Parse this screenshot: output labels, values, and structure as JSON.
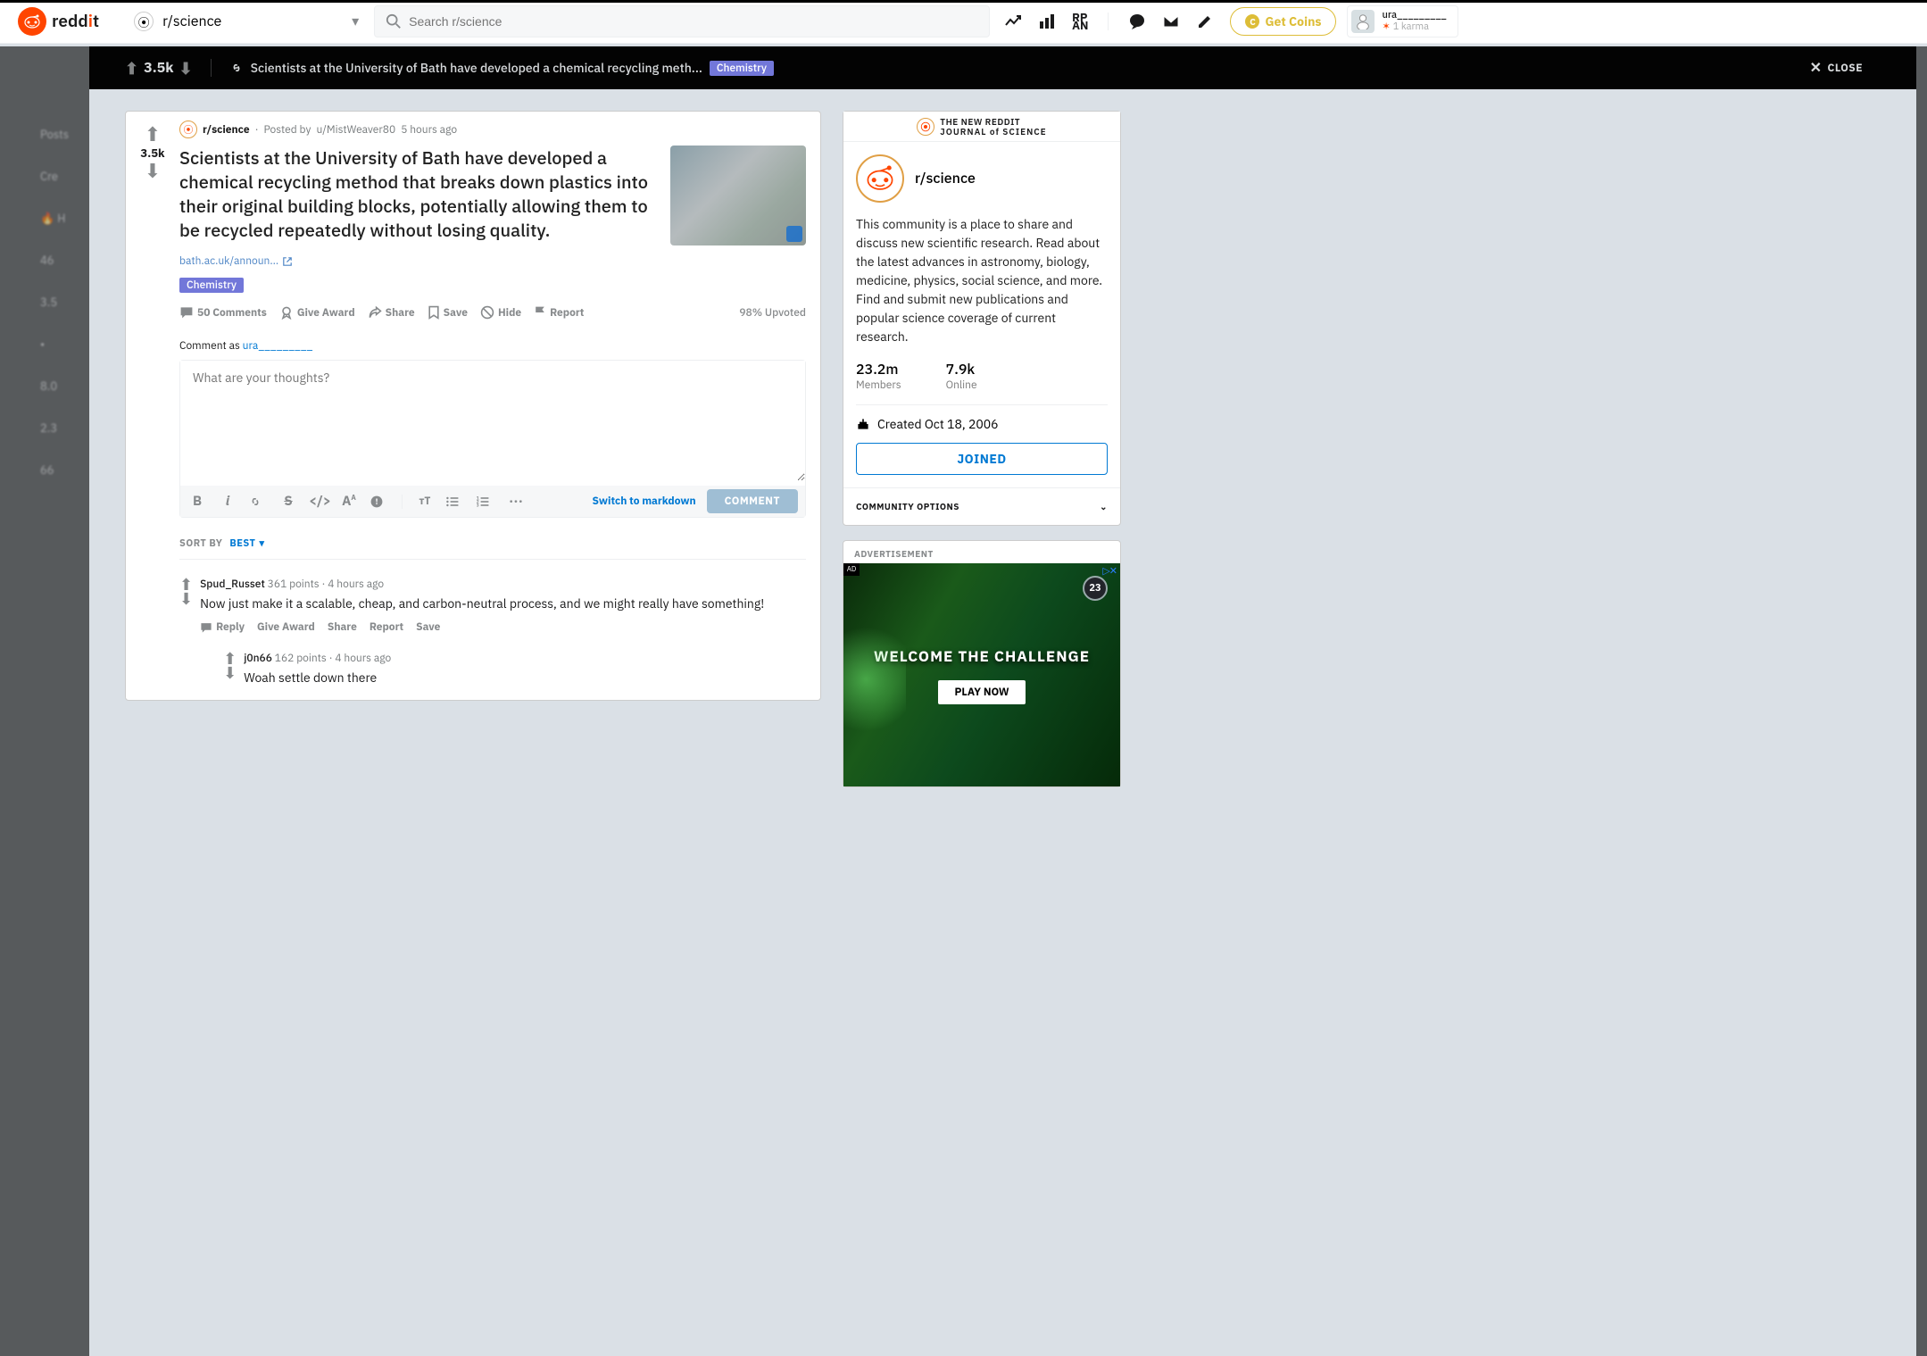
{
  "header": {
    "brand": "reddit",
    "community_selector": "r/science",
    "search_placeholder": "Search r/science",
    "coins_label": "Get Coins",
    "user": {
      "name": "ura_________",
      "karma": "1 karma"
    }
  },
  "overlay": {
    "score": "3.5k",
    "title_short": "Scientists at the University of Bath have developed a chemical recycling meth...",
    "flair": "Chemistry",
    "close": "CLOSE"
  },
  "post": {
    "score": "3.5k",
    "subreddit": "r/science",
    "posted_by_prefix": "Posted by",
    "author": "u/MistWeaver80",
    "age": "5 hours ago",
    "title": "Scientists at the University of Bath have developed a chemical recycling method that breaks down plastics into their original building blocks, potentially allowing them to be recycled repeatedly without losing quality.",
    "outlink": "bath.ac.uk/announ...",
    "flair": "Chemistry",
    "actions": {
      "comments": "50 Comments",
      "award": "Give Award",
      "share": "Share",
      "save": "Save",
      "hide": "Hide",
      "report": "Report",
      "upvoted": "98% Upvoted"
    }
  },
  "comment_editor": {
    "label_prefix": "Comment as",
    "username": "ura_________",
    "placeholder": "What are your thoughts?",
    "markdown": "Switch to markdown",
    "submit": "COMMENT"
  },
  "sort": {
    "label": "SORT BY",
    "value": "BEST"
  },
  "comments": [
    {
      "author": "Spud_Russet",
      "points": "361 points",
      "age": "4 hours ago",
      "body": "Now just make it a scalable, cheap, and carbon-neutral process, and we might really have something!",
      "actions": {
        "reply": "Reply",
        "award": "Give Award",
        "share": "Share",
        "report": "Report",
        "save": "Save"
      }
    },
    {
      "author": "j0n66",
      "points": "162 points",
      "age": "4 hours ago",
      "body": "Woah settle down there"
    }
  ],
  "sidebar": {
    "journal_line1": "THE NEW REDDIT",
    "journal_line2": "JOURNAL of SCIENCE",
    "community": "r/science",
    "description": "This community is a place to share and discuss new scientific research. Read about the latest advances in astronomy, biology, medicine, physics, social science, and more. Find and submit new publications and popular science coverage of current research.",
    "members_v": "23.2m",
    "members_l": "Members",
    "online_v": "7.9k",
    "online_l": "Online",
    "created": "Created Oct 18, 2006",
    "joined": "JOINED",
    "options": "COMMUNITY OPTIONS",
    "ad_label": "ADVERTISEMENT",
    "ad_text": "WELCOME THE CHALLENGE",
    "ad_cta": "PLAY NOW",
    "ad_num": "23"
  },
  "bg_side": {
    "posts": "Posts",
    "create": "Cre",
    "items": [
      "46",
      "3.5",
      "8.0",
      "2.3",
      "66"
    ]
  }
}
